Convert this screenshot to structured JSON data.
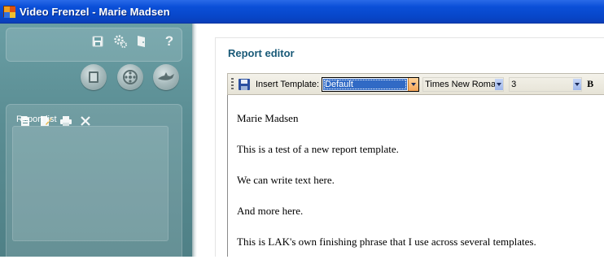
{
  "window": {
    "title": "Video Frenzel - Marie Madsen"
  },
  "sidebar": {
    "top_icons": [
      "save-icon",
      "settings-icon",
      "exit-door-icon",
      "help-icon"
    ],
    "help_glyph": "?",
    "media_icons": [
      "video-tape-icon",
      "film-reel-icon",
      "shark-icon"
    ],
    "report_icons": [
      "new-report-icon",
      "edit-report-icon",
      "print-icon",
      "delete-icon"
    ],
    "report_list_label": "Report list"
  },
  "editor": {
    "title": "Report editor",
    "toolbar": {
      "insert_template_label": "Insert Template:",
      "template_value": "Default",
      "font_value": "Times New Roman",
      "size_value": "3",
      "bold_label": "B"
    },
    "paragraphs": [
      "Marie Madsen",
      "This is a test of a new report template.",
      "We can write text here.",
      "And more here.",
      "This is LAK's own finishing phrase that I use across several templates."
    ]
  },
  "colors": {
    "titlebar": "#0a4fd8",
    "sidebar": "#5b8e94",
    "accent_title": "#1a5a78",
    "selection": "#316ac5"
  }
}
